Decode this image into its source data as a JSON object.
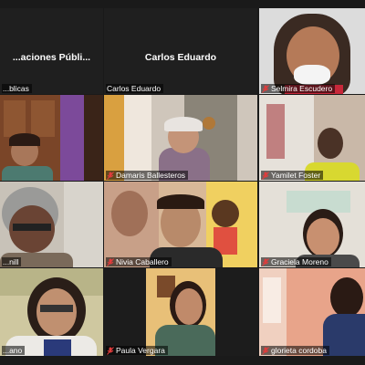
{
  "tiles": [
    {
      "label": "...blicas",
      "center_name": "...aciones Públi...",
      "muted": false
    },
    {
      "label": "Carlos Eduardo",
      "center_name": "Carlos Eduardo",
      "muted": false
    },
    {
      "label": "Selmira Escudero",
      "muted": true
    },
    {
      "label": "",
      "muted": false
    },
    {
      "label": "Damaris Ballesteros",
      "muted": true
    },
    {
      "label": "Yamilet Foster",
      "muted": true
    },
    {
      "label": "...nill",
      "muted": false
    },
    {
      "label": "Nivia Caballero",
      "muted": true
    },
    {
      "label": "Graciela Moreno",
      "muted": true
    },
    {
      "label": "...ano",
      "muted": false
    },
    {
      "label": "Paula Vergara",
      "muted": true
    },
    {
      "label": "glorieta cordoba",
      "muted": true
    }
  ],
  "colors": {
    "mic_muted": "#e03c3c",
    "background": "#1a1a1a"
  }
}
